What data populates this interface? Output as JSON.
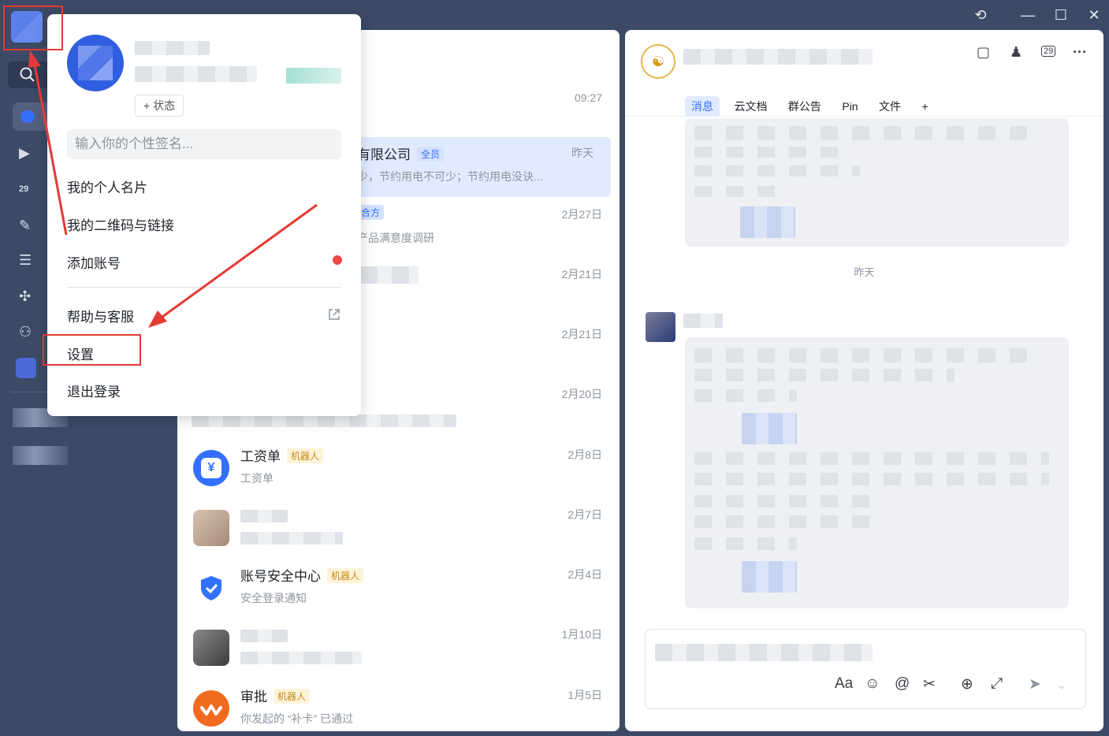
{
  "window": {
    "controls": {
      "history_glyph": "⟲",
      "minimize_glyph": "—",
      "maximize_glyph": "☐",
      "close_glyph": "✕"
    }
  },
  "profile_menu": {
    "status_button": "+ 状态",
    "signature_placeholder": "输入你的个性签名...",
    "items": {
      "business_card": "我的个人名片",
      "qr_code": "我的二维码与链接",
      "add_account": "添加账号",
      "help": "帮助与客服",
      "settings": "设置",
      "logout": "退出登录"
    }
  },
  "conversations": [
    {
      "name": "",
      "preview": "",
      "time": "09:27"
    },
    {
      "name": "有限公司",
      "tag": "全员",
      "preview": "少，节约用电不可少；节约用电没诀...",
      "time": "昨天"
    },
    {
      "name": "",
      "tag": "合方",
      "preview": "产品满意度调研",
      "time": "2月27日"
    },
    {
      "name": "",
      "preview": "",
      "time": "2月21日"
    },
    {
      "name": "",
      "preview": "",
      "time": "2月21日"
    },
    {
      "name": "",
      "preview": "",
      "time": "2月20日"
    },
    {
      "name": "工资单",
      "tag": "机器人",
      "preview": "工资单",
      "time": "2月8日"
    },
    {
      "name": "",
      "preview": "",
      "time": "2月7日"
    },
    {
      "name": "账号安全中心",
      "tag": "机器人",
      "preview": "安全登录通知",
      "time": "2月4日"
    },
    {
      "name": "",
      "preview": "",
      "time": "1月10日"
    },
    {
      "name": "审批",
      "tag": "机器人",
      "preview": "你发起的 “补卡” 已通过",
      "time": "1月5日"
    }
  ],
  "chat": {
    "tabs": [
      "消息",
      "云文档",
      "群公告",
      "Pin",
      "文件",
      "+"
    ],
    "date_separator": "昨天"
  },
  "colors": {
    "sidebar_bg": "#3d4a66",
    "accent": "#3370ff",
    "bot_tag": "#c58a14",
    "highlight_red": "#e53935"
  }
}
